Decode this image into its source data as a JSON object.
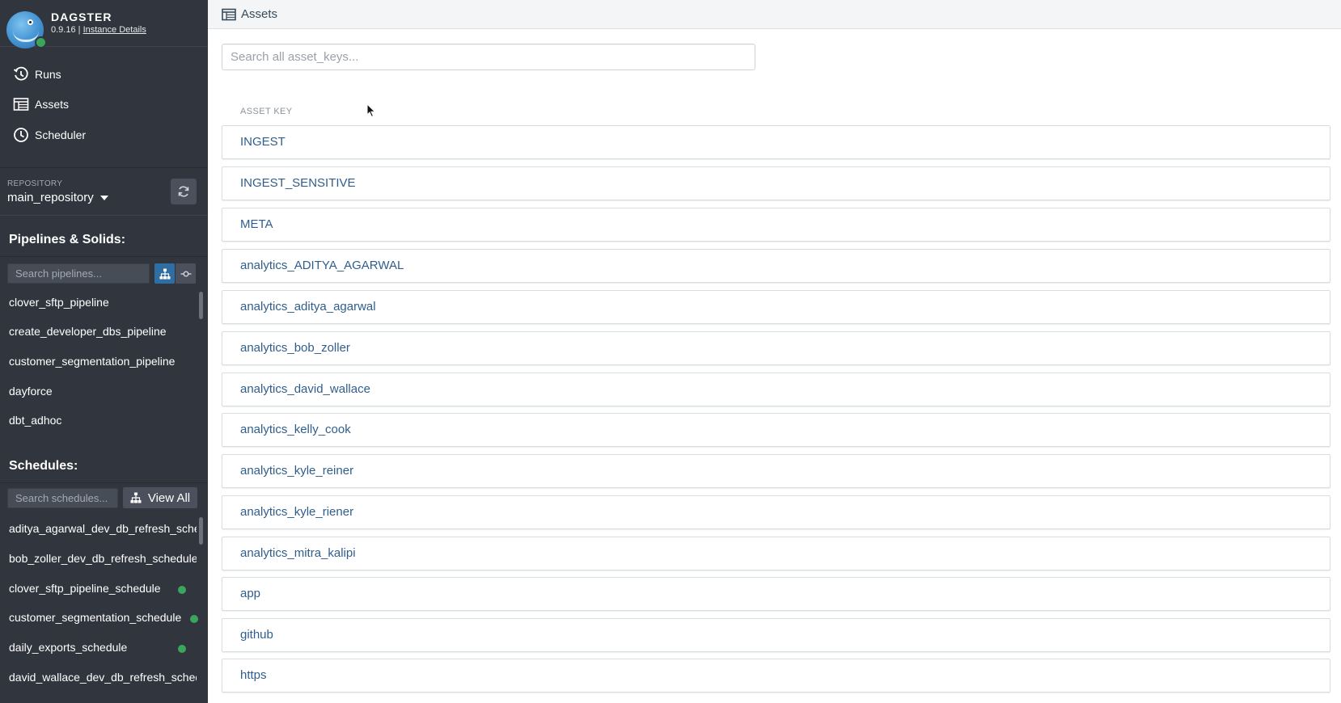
{
  "brand": {
    "name": "DAGSTER",
    "version": "0.9.16",
    "separator": "|",
    "instance_link": "Instance Details"
  },
  "nav": [
    {
      "label": "Runs",
      "icon": "history-icon"
    },
    {
      "label": "Assets",
      "icon": "table-icon"
    },
    {
      "label": "Scheduler",
      "icon": "clock-icon"
    }
  ],
  "repository": {
    "caption": "REPOSITORY",
    "name": "main_repository"
  },
  "pipelines": {
    "title": "Pipelines & Solids:",
    "search_placeholder": "Search pipelines...",
    "items": [
      "clover_sftp_pipeline",
      "create_developer_dbs_pipeline",
      "customer_segmentation_pipeline",
      "dayforce",
      "dbt_adhoc"
    ]
  },
  "schedules": {
    "title": "Schedules:",
    "search_placeholder": "Search schedules...",
    "view_all_label": "View All",
    "items": [
      {
        "label": "aditya_agarwal_dev_db_refresh_schedule",
        "running": false
      },
      {
        "label": "bob_zoller_dev_db_refresh_schedule",
        "running": false
      },
      {
        "label": "clover_sftp_pipeline_schedule",
        "running": true
      },
      {
        "label": "customer_segmentation_schedule",
        "running": true
      },
      {
        "label": "daily_exports_schedule",
        "running": true
      },
      {
        "label": "david_wallace_dev_db_refresh_schedule",
        "running": false
      }
    ]
  },
  "main": {
    "title": "Assets",
    "search_placeholder": "Search all asset_keys...",
    "column_header": "ASSET KEY",
    "assets": [
      "INGEST",
      "INGEST_SENSITIVE",
      "META",
      "analytics_ADITYA_AGARWAL",
      "analytics_aditya_agarwal",
      "analytics_bob_zoller",
      "analytics_david_wallace",
      "analytics_kelly_cook",
      "analytics_kyle_reiner",
      "analytics_kyle_riener",
      "analytics_mitra_kalipi",
      "app",
      "github",
      "https"
    ]
  },
  "colors": {
    "sidebar_bg": "#30353e",
    "accent_blue": "#2f5e8c",
    "status_green": "#3ba55c"
  }
}
